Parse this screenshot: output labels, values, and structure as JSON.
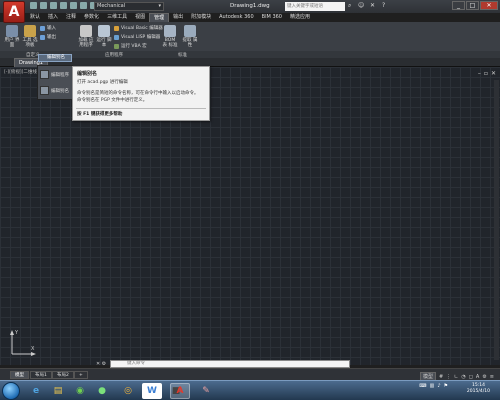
{
  "titlebar": {
    "workspace": "Mechanical",
    "doc_title": "Drawing1.dwg",
    "search_placeholder": "键入关键字或短语",
    "minimize": "_",
    "maximize": "□",
    "close": "✕"
  },
  "tabs": [
    "默认",
    "插入",
    "注释",
    "参数化",
    "三维工具",
    "视图",
    "管理",
    "输出",
    "附加模块",
    "Autodesk 360",
    "BIM 360",
    "精选应用"
  ],
  "active_tab_index": 6,
  "ribbon": {
    "btn_user_interface": "用户\n界面",
    "btn_tool_palettes": "工具\n选项板",
    "btn_import": "输入",
    "btn_export": "输出",
    "btn_edit_aliases": "编辑别名",
    "btn_load_app": "加载\n应用程序",
    "btn_run_script": "运行\n脚本",
    "btn_vb_editor": "Visual Basic 编辑器",
    "btn_vlisp_editor": "Visual LISP 编辑器",
    "btn_run_vba": "运行 VBA 宏",
    "btn_bom": "BOM 表\n标准",
    "btn_extract": "提取\n属性",
    "panel_customization": "自定义",
    "panel_applications": "应用程序",
    "panel_standards": "标准"
  },
  "file_tab": "Drawing1",
  "viewport_label": "[-][俯视][二维线框]",
  "dropdown": {
    "active_item": "编辑别名",
    "item1": "编辑程序",
    "item2": "编辑别名"
  },
  "tooltip": {
    "title": "编辑别名",
    "line1": "打开 acad.pgp 进行编辑",
    "line2": "命令别名是简短的命令名称，可在命令行中输入以启动命令。",
    "line3": "命令别名在 PGP 文件中进行定义。",
    "footer": "按 F1 键获得更多帮助"
  },
  "cmdline": {
    "placeholder": "键入命令"
  },
  "status": {
    "model_tab": "模型",
    "layout1": "布局1",
    "layout2": "布局2",
    "model_btn": "模型"
  },
  "clock": {
    "time": "15:14",
    "date": "2015/4/10"
  },
  "colors": {
    "canvas_bg": "#21252b",
    "ribbon_bg": "#3b3f45",
    "accent_red": "#d23a2c",
    "taskbar": "#2f4c6c"
  }
}
